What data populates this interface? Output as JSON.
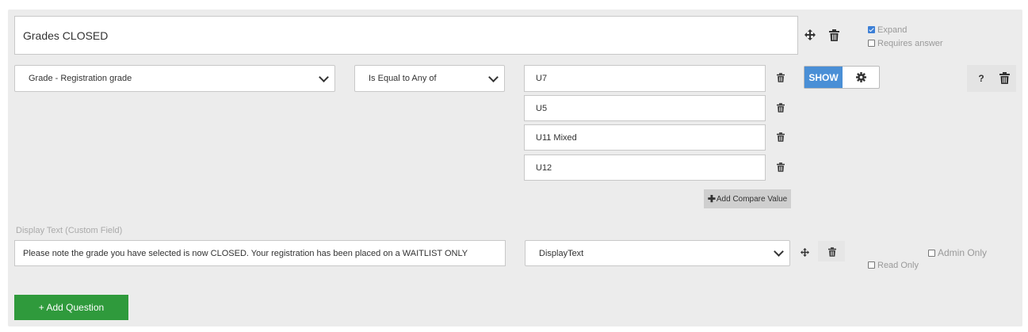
{
  "question": {
    "title": "Grades CLOSED",
    "expand_label": "Expand",
    "expand_checked": true,
    "requires_answer_label": "Requires answer",
    "requires_answer_checked": false
  },
  "condition": {
    "field_select": "Grade - Registration grade",
    "operator_select": "Is Equal to Any of",
    "compare_values": [
      "U7",
      "U5",
      "U11 Mixed",
      "U12"
    ],
    "add_compare_label": "Add Compare Value",
    "action_label": "SHOW",
    "help_label": "?"
  },
  "display_field": {
    "section_label": "Display Text (Custom Field)",
    "text_value": "Please note the grade you have selected is now CLOSED. Your registration has been placed on a WAITLIST ONLY",
    "type_select": "DisplayText",
    "admin_only_label": "Admin Only",
    "admin_only_checked": false,
    "read_only_label": "Read Only",
    "read_only_checked": false
  },
  "footer": {
    "add_question_label": "+ Add Question"
  },
  "colors": {
    "show_button": "#4a8fd6",
    "add_question_button": "#2f9a3c",
    "panel_background": "#ececec"
  },
  "icons": [
    "move-icon",
    "trash-icon",
    "gear-icon",
    "chevron-down-icon",
    "plus-icon"
  ]
}
